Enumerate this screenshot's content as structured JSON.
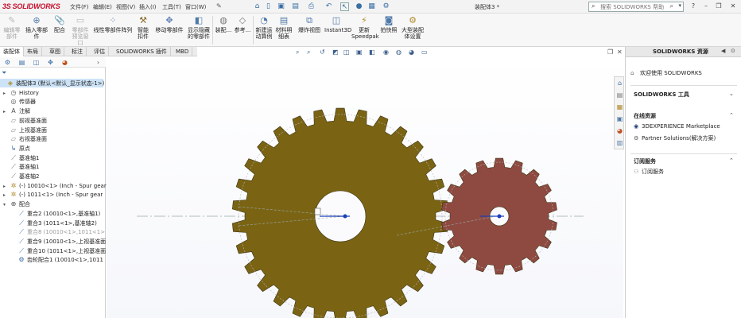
{
  "titlebar": {
    "logo_ds": "3S",
    "logo_word": "SOLIDWORKS",
    "menu": [
      "文件(F)",
      "编辑(E)",
      "视图(V)",
      "插入(I)",
      "工具(T)",
      "窗口(W)"
    ],
    "pin_icon": "pin-icon",
    "document_title": "装配体3 *",
    "search_placeholder": "搜索 SOLIDWORKS 帮助",
    "window_buttons": [
      "?",
      "–",
      "❐",
      "✕"
    ]
  },
  "ribbon": {
    "buttons": [
      {
        "label": "编辑零部件",
        "disabled": true
      },
      {
        "label": "插入零部件",
        "disabled": false
      },
      {
        "label": "配合",
        "disabled": false
      },
      {
        "label": "零部件预览窗口",
        "disabled": true
      },
      {
        "label": "线性零部件阵列",
        "disabled": false
      },
      {
        "label": "智能扣件",
        "disabled": false
      },
      {
        "label": "移动零部件",
        "disabled": false
      },
      {
        "label": "显示隐藏的零部件",
        "disabled": false
      },
      {
        "label": "装配...",
        "disabled": false
      },
      {
        "label": "参考...",
        "disabled": false
      },
      {
        "label": "新建运动算例",
        "disabled": false
      },
      {
        "label": "材料明细表",
        "disabled": false
      },
      {
        "label": "爆炸视图",
        "disabled": false
      },
      {
        "label": "Instant3D",
        "disabled": false
      },
      {
        "label": "更新Speedpak",
        "disabled": false
      },
      {
        "label": "拍快照",
        "disabled": false
      },
      {
        "label": "大型装配体设置",
        "disabled": false
      }
    ]
  },
  "tabs": [
    "装配体",
    "布局",
    "草图",
    "标注",
    "评估",
    "SOLIDWORKS 插件",
    "MBD"
  ],
  "tree": {
    "filter_icon": "filter-icon",
    "items": [
      {
        "label": "装配体3 (默认<默认_显示状态-1>)",
        "indent": 0,
        "twisty": "",
        "icon": "assembly-icon",
        "root": true
      },
      {
        "label": "History",
        "indent": 1,
        "twisty": "▸",
        "icon": "history-icon"
      },
      {
        "label": "传感器",
        "indent": 1,
        "twisty": "",
        "icon": "sensor-icon"
      },
      {
        "label": "注解",
        "indent": 1,
        "twisty": "▸",
        "icon": "annotation-icon"
      },
      {
        "label": "前视基准面",
        "indent": 1,
        "twisty": "",
        "icon": "plane-icon"
      },
      {
        "label": "上视基准面",
        "indent": 1,
        "twisty": "",
        "icon": "plane-icon"
      },
      {
        "label": "右视基准面",
        "indent": 1,
        "twisty": "",
        "icon": "plane-icon"
      },
      {
        "label": "原点",
        "indent": 1,
        "twisty": "",
        "icon": "origin-icon"
      },
      {
        "label": "基准轴1",
        "indent": 1,
        "twisty": "",
        "icon": "axis-icon"
      },
      {
        "label": "基准轴1",
        "indent": 1,
        "twisty": "",
        "icon": "axis-icon"
      },
      {
        "label": "基准轴2",
        "indent": 1,
        "twisty": "",
        "icon": "axis-icon"
      },
      {
        "label": "(-) 10010<1> (Inch - Spur gear",
        "indent": 1,
        "twisty": "▸",
        "icon": "part-icon"
      },
      {
        "label": "(-) 1011<1> (Inch - Spur gear",
        "indent": 1,
        "twisty": "▸",
        "icon": "part-icon"
      },
      {
        "label": "配合",
        "indent": 1,
        "twisty": "▾",
        "icon": "mates-icon"
      },
      {
        "label": "重合2 (10010<1>,基准轴1)",
        "indent": 2,
        "twisty": "",
        "icon": "coincident-icon"
      },
      {
        "label": "重合3 (1011<1>,基准轴2)",
        "indent": 2,
        "twisty": "",
        "icon": "coincident-icon"
      },
      {
        "label": "重合8 (10010<1>,1011<1>",
        "indent": 2,
        "twisty": "",
        "icon": "coincident-icon",
        "dim": true
      },
      {
        "label": "重合9 (10010<1>,上视基准面",
        "indent": 2,
        "twisty": "",
        "icon": "coincident-icon"
      },
      {
        "label": "重合10 (1011<1>,上视基准面",
        "indent": 2,
        "twisty": "",
        "icon": "coincident-icon"
      },
      {
        "label": "齿轮配合1 (10010<1>,1011",
        "indent": 2,
        "twisty": "",
        "icon": "gear-mate-icon"
      }
    ]
  },
  "taskpane": {
    "title": "SOLIDWORKS 资源",
    "welcome": "欢迎使用 SOLIDWORKS",
    "tools_header": "SOLIDWORKS 工具",
    "online_header": "在线资源",
    "online_items": [
      "3DEXPERIENCE Marketplace",
      "Partner Solutions(解决方案)"
    ],
    "subscription_header": "订阅服务",
    "subscription_items": [
      "订阅服务"
    ]
  },
  "colors": {
    "large_gear": "#7a6414",
    "small_gear": "#8e4a41",
    "accent": "#3a6ea5",
    "tree_selected": "#cde3f7"
  },
  "gears": {
    "large": {
      "teeth": 30
    },
    "small": {
      "teeth": 18
    }
  }
}
